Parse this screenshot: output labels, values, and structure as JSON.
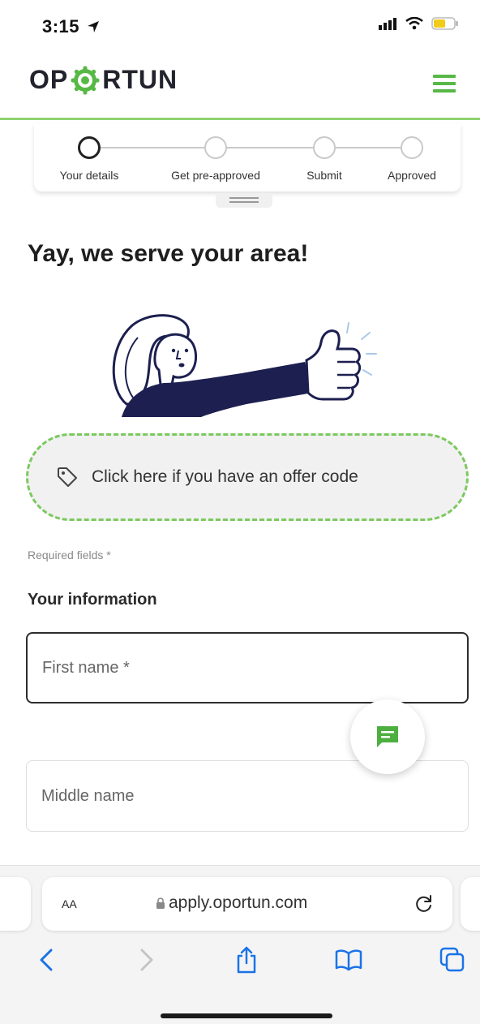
{
  "status_bar": {
    "time": "3:15"
  },
  "header": {
    "logo_prefix": "OP",
    "logo_suffix": "RTUN"
  },
  "stepper": {
    "steps": [
      {
        "label": "Your details",
        "active": true
      },
      {
        "label": "Get pre-approved",
        "active": false
      },
      {
        "label": "Submit",
        "active": false
      },
      {
        "label": "Approved",
        "active": false
      }
    ]
  },
  "main": {
    "headline": "Yay, we serve your area!",
    "offer_code_text": "Click here if you have an offer code",
    "required_note": "Required fields *",
    "section_title": "Your information",
    "first_name_placeholder": "First name *",
    "middle_name_placeholder": "Middle name"
  },
  "browser": {
    "aa_label": "AA",
    "url": "apply.oportun.com"
  },
  "colors": {
    "brand_green": "#57b846",
    "dashed_border": "#7bc95e",
    "header_underline": "#8fd36f",
    "safari_blue": "#1a73e8"
  },
  "icons": [
    "location-arrow-icon",
    "signal-icon",
    "wifi-icon",
    "battery-icon",
    "menu-icon",
    "tag-icon",
    "chat-icon",
    "lock-icon",
    "reload-icon",
    "back-icon",
    "forward-icon",
    "share-icon",
    "bookmarks-icon",
    "tabs-icon"
  ]
}
